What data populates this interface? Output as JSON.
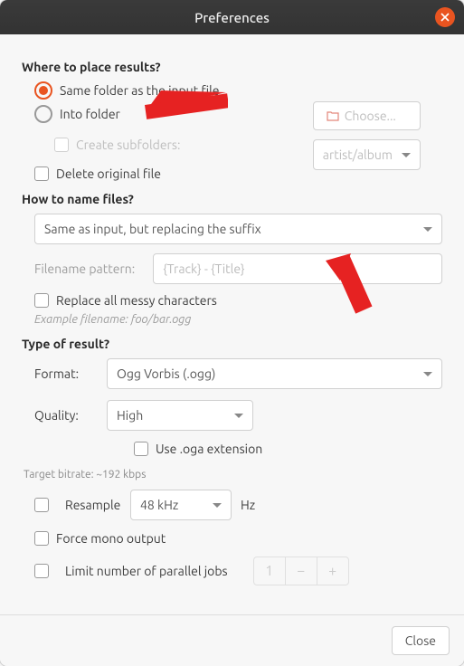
{
  "titlebar": {
    "title": "Preferences"
  },
  "section1": {
    "heading": "Where to place results?",
    "opt_same": "Same folder as the input file",
    "opt_into": "Into folder",
    "choose_btn": "Choose...",
    "create_sub": "Create subfolders:",
    "subfolder_pattern": "artist/album",
    "delete_orig": "Delete original file"
  },
  "section2": {
    "heading": "How to name files?",
    "naming_mode": "Same as input, but replacing the suffix",
    "pattern_label": "Filename pattern:",
    "pattern_value": "{Track} - {Title}",
    "replace_messy": "Replace all messy characters",
    "example": "Example filename: foo/bar.ogg"
  },
  "section3": {
    "heading": "Type of result?",
    "format_label": "Format:",
    "format_value": "Ogg Vorbis (.ogg)",
    "quality_label": "Quality:",
    "quality_value": "High",
    "oga": "Use .oga extension",
    "bitrate": "Target bitrate: ~192 kbps",
    "resample": "Resample",
    "resample_value": "48 kHz",
    "hz": "Hz",
    "mono": "Force mono output",
    "limit_jobs": "Limit number of parallel jobs",
    "jobs_value": "1"
  },
  "footer": {
    "close": "Close"
  }
}
